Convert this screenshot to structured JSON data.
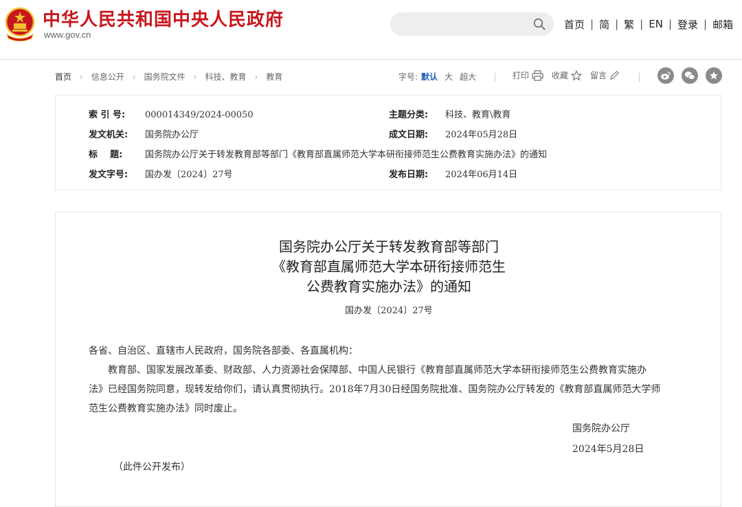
{
  "header": {
    "site_title": "中华人民共和国中央人民政府",
    "site_url": "www.gov.cn",
    "search_placeholder": "",
    "nav": [
      "首页",
      "简",
      "繁",
      "EN",
      "登录",
      "邮箱"
    ],
    "nav_separator": "|"
  },
  "colors": {
    "brand_red": "#c8161d",
    "active_blue": "#1a5fb4",
    "emblem_gold": "#f2c230"
  },
  "breadcrumb": [
    "首页",
    "信息公开",
    "国务院文件",
    "科技、教育",
    "教育"
  ],
  "toolbar": {
    "font_size_label": "字号:",
    "font_sizes": [
      "默认",
      "大",
      "超大"
    ],
    "active_font_size": "默认",
    "print_label": "打印",
    "favorite_label": "收藏",
    "comment_label": "留言",
    "share_icons": [
      "weibo-icon",
      "wechat-icon",
      "star-badge-icon"
    ]
  },
  "metadata": {
    "index_label": "索 引 号:",
    "index_value": "000014349/2024-00050",
    "category_label": "主题分类:",
    "category_value": "科技、教育\\教育",
    "issuer_label": "发文机关:",
    "issuer_value": "国务院办公厅",
    "written_date_label": "成文日期:",
    "written_date_value": "2024年05月28日",
    "title_label": "标    题:",
    "title_value": "国务院办公厅关于转发教育部等部门《教育部直属师范大学本研衔接师范生公费教育实施办法》的通知",
    "doc_no_label": "发文字号:",
    "doc_no_value": "国办发〔2024〕27号",
    "publish_date_label": "发布日期:",
    "publish_date_value": "2024年06月14日"
  },
  "article": {
    "title_lines": [
      "国务院办公厅关于转发教育部等部门",
      "《教育部直属师范大学本研衔接师范生",
      "公费教育实施办法》的通知"
    ],
    "doc_no": "国办发〔2024〕27号",
    "salutation": "各省、自治区、直辖市人民政府，国务院各部委、各直属机构：",
    "paragraph_lines": [
      "教育部、国家发展改革委、财政部、人力资源社会保障部、中国人民银行《教育部直属师范大学本研衔接师范生公费教育实施办",
      "法》已经国务院同意，现转发给你们，请认真贯彻执行。2018年7月30日经国务院批准、国务院办公厅转发的《教育部直属师范大学师",
      "范生公费教育实施办法》同时废止。"
    ],
    "signature_org": "国务院办公厅",
    "signature_date": "2024年5月28日",
    "public_note": "（此件公开发布）"
  }
}
